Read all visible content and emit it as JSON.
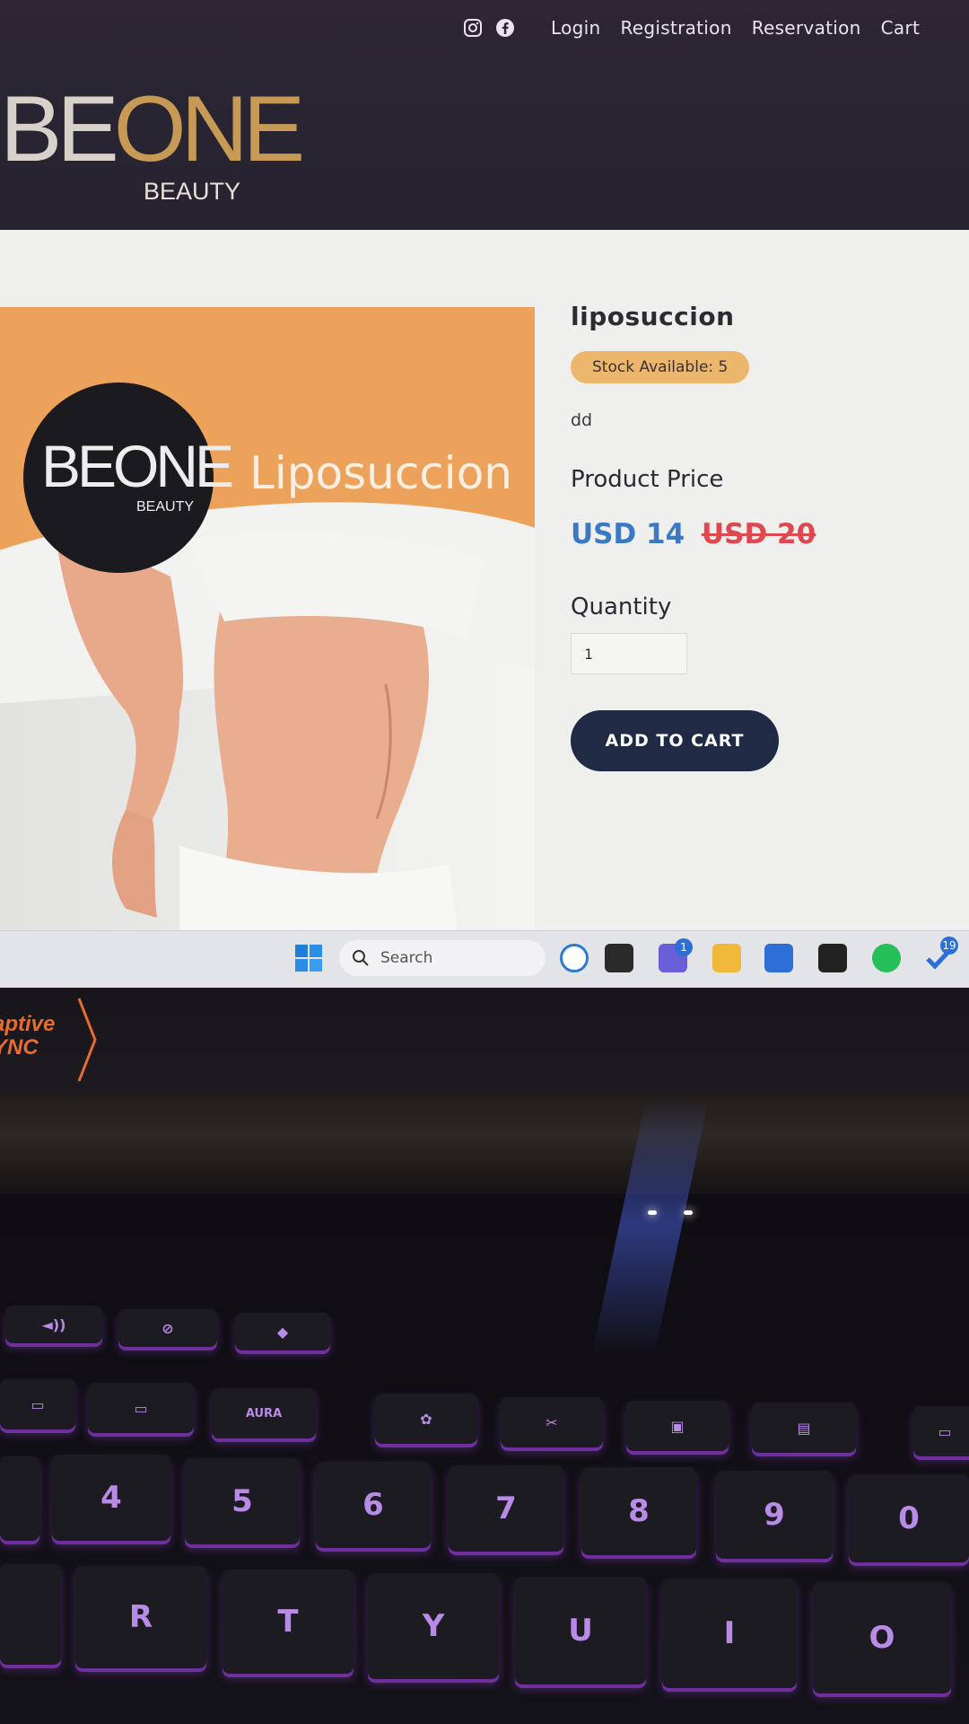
{
  "nav": {
    "links": [
      "Login",
      "Registration",
      "Reservation",
      "Cart"
    ]
  },
  "brand": {
    "word_be": "BE",
    "word_one": "ONE",
    "sub": "BEAUTY"
  },
  "product": {
    "name": "liposuccion",
    "stock": "Stock Available: 5",
    "description": "dd",
    "price_label": "Product Price",
    "price_now": "USD 14",
    "price_old": "USD 20",
    "quantity_label": "Quantity",
    "quantity_value": "1",
    "add_to_cart": "ADD TO CART",
    "image_title": "Liposuccion"
  },
  "taskbar": {
    "search_placeholder": "Search",
    "chat_badge": "1",
    "todo_badge": "19"
  },
  "laptop": {
    "bezel_line1": "aptive",
    "bezel_line2": "YNC"
  },
  "keys": {
    "row_num": [
      "$",
      "4",
      "%",
      "5",
      "^",
      "6",
      "&",
      "7",
      "*",
      "8",
      "(",
      "9",
      ")",
      "0"
    ],
    "row_alpha": [
      "R",
      "T",
      "Y",
      "U",
      "I",
      "O"
    ],
    "fn_label_aura": "AURA"
  },
  "colors": {
    "header_bg": "#2c2733",
    "accent_gold": "#c69a55",
    "stock_badge": "#ecb66d",
    "price_now": "#3a79c4",
    "price_old": "#e0484f",
    "cart_button": "#1f2a44",
    "keyboard_glow": "#8a3ccf"
  }
}
